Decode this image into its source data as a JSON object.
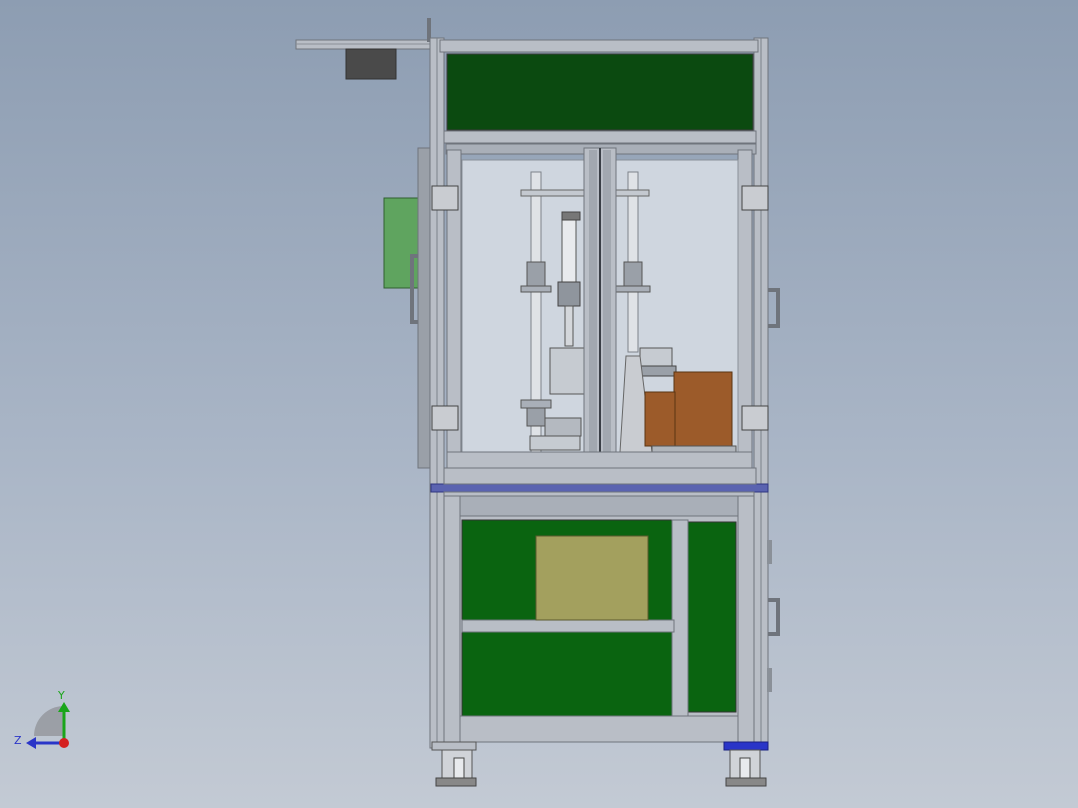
{
  "viewport": {
    "background_top": "#8d9db2",
    "background_bottom": "#c3cad4"
  },
  "machine": {
    "frame_color": "#b9bec6",
    "frame_dark": "#6f747c",
    "upper_panel_color": "#0b4a10",
    "lower_panel_color": "#0a6410",
    "divider_color": "#5a63b0",
    "side_box_color": "#5fa45f",
    "control_box_color": "#4a4a4a",
    "brown_block_color": "#9c5b2a",
    "tan_plate_color": "#a3a05e",
    "glass_color": "#cfd6df"
  },
  "triad": {
    "y_label": "Y",
    "z_label": "Z",
    "y_color": "#1aa51a",
    "z_color": "#2a35c8",
    "origin_color": "#d42020"
  }
}
